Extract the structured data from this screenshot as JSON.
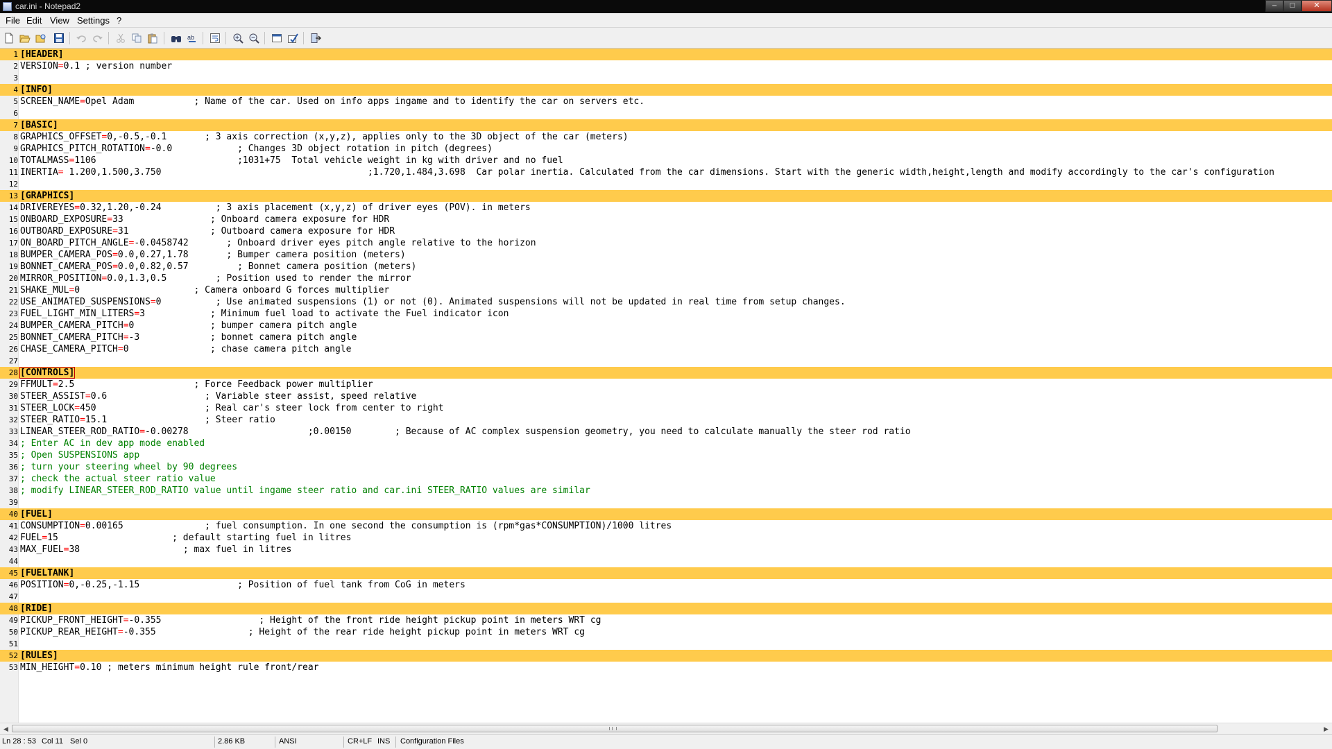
{
  "window": {
    "title": "car.ini - Notepad2",
    "controls": {
      "minimize": "–",
      "maximize": "□",
      "close": "✕"
    }
  },
  "menu": [
    "File",
    "Edit",
    "View",
    "Settings",
    "?"
  ],
  "toolbar": [
    "new-file-icon",
    "open-file-icon",
    "browse-icon",
    "save-icon",
    "undo-icon",
    "redo-icon",
    "cut-icon",
    "copy-icon",
    "paste-icon",
    "find-icon",
    "replace-icon",
    "word-wrap-icon",
    "zoom-in-icon",
    "zoom-out-icon",
    "scheme-icon",
    "customize-icon",
    "exit-icon"
  ],
  "editor": {
    "highlight_color": "#ffcb4c",
    "current_line": 28,
    "lines": [
      "[HEADER]",
      "VERSION=0.1 ; version number",
      "",
      "[INFO]",
      "SCREEN_NAME=Opel Adam           ; Name of the car. Used on info apps ingame and to identify the car on servers etc.",
      "",
      "[BASIC]",
      "GRAPHICS_OFFSET=0,-0.5,-0.1       ; 3 axis correction (x,y,z), applies only to the 3D object of the car (meters)",
      "GRAPHICS_PITCH_ROTATION=-0.0            ; Changes 3D object rotation in pitch (degrees)",
      "TOTALMASS=1106                          ;1031+75  Total vehicle weight in kg with driver and no fuel",
      "INERTIA= 1.200,1.500,3.750                                      ;1.720,1.484,3.698  Car polar inertia. Calculated from the car dimensions. Start with the generic width,height,length and modify accordingly to the car's configuration",
      "",
      "[GRAPHICS]",
      "DRIVEREYES=0.32,1.20,-0.24          ; 3 axis placement (x,y,z) of driver eyes (POV). in meters",
      "ONBOARD_EXPOSURE=33                ; Onboard camera exposure for HDR",
      "OUTBOARD_EXPOSURE=31               ; Outboard camera exposure for HDR",
      "ON_BOARD_PITCH_ANGLE=-0.0458742       ; Onboard driver eyes pitch angle relative to the horizon",
      "BUMPER_CAMERA_POS=0.0,0.27,1.78       ; Bumper camera position (meters)",
      "BONNET_CAMERA_POS=0.0,0.82,0.57         ; Bonnet camera position (meters)",
      "MIRROR_POSITION=0.0,1.3,0.5         ; Position used to render the mirror",
      "SHAKE_MUL=0                     ; Camera onboard G forces multiplier",
      "USE_ANIMATED_SUSPENSIONS=0          ; Use animated suspensions (1) or not (0). Animated suspensions will not be updated in real time from setup changes.",
      "FUEL_LIGHT_MIN_LITERS=3            ; Minimum fuel load to activate the Fuel indicator icon",
      "BUMPER_CAMERA_PITCH=0              ; bumper camera pitch angle",
      "BONNET_CAMERA_PITCH=-3             ; bonnet camera pitch angle",
      "CHASE_CAMERA_PITCH=0               ; chase camera pitch angle",
      "",
      "[CONTROLS]",
      "FFMULT=2.5                      ; Force Feedback power multiplier",
      "STEER_ASSIST=0.6                  ; Variable steer assist, speed relative",
      "STEER_LOCK=450                    ; Real car's steer lock from center to right",
      "STEER_RATIO=15.1                  ; Steer ratio",
      "LINEAR_STEER_ROD_RATIO=-0.00278                      ;0.00150        ; Because of AC complex suspension geometry, you need to calculate manually the steer rod ratio",
      "; Enter AC in dev app mode enabled",
      "; Open SUSPENSIONS app",
      "; turn your steering wheel by 90 degrees",
      "; check the actual steer ratio value",
      "; modify LINEAR_STEER_ROD_RATIO value until ingame steer ratio and car.ini STEER_RATIO values are similar",
      "",
      "[FUEL]",
      "CONSUMPTION=0.00165               ; fuel consumption. In one second the consumption is (rpm*gas*CONSUMPTION)/1000 litres",
      "FUEL=15                     ; default starting fuel in litres",
      "MAX_FUEL=38                   ; max fuel in litres",
      "",
      "[FUELTANK]",
      "POSITION=0,-0.25,-1.15                  ; Position of fuel tank from CoG in meters",
      "",
      "[RIDE]",
      "PICKUP_FRONT_HEIGHT=-0.355                  ; Height of the front ride height pickup point in meters WRT cg",
      "PICKUP_REAR_HEIGHT=-0.355                 ; Height of the rear ride height pickup point in meters WRT cg",
      "",
      "[RULES]",
      "MIN_HEIGHT=0.10 ; meters minimum height rule front/rear"
    ]
  },
  "scrollbar": {
    "left": "◀",
    "right": "▶"
  },
  "status": {
    "position": "Ln 28 : 53",
    "col": "Col 11",
    "sel": "Sel 0",
    "size": "2.86 KB",
    "encoding": "ANSI",
    "eol": "CR+LF",
    "mode": "INS",
    "scheme": "Configuration Files"
  }
}
